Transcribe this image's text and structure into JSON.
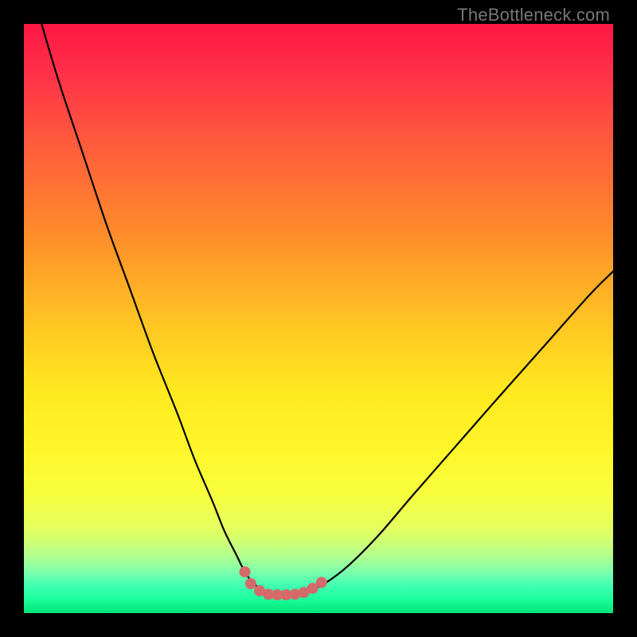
{
  "watermark": "TheBottleneck.com",
  "colors": {
    "black": "#000000",
    "curve": "#000000",
    "marker": "#d46a6a",
    "gradient_stops": [
      {
        "offset": 0.0,
        "color": "#ff1744"
      },
      {
        "offset": 0.08,
        "color": "#ff2f49"
      },
      {
        "offset": 0.2,
        "color": "#ff5a3c"
      },
      {
        "offset": 0.35,
        "color": "#ff8a2b"
      },
      {
        "offset": 0.5,
        "color": "#ffc223"
      },
      {
        "offset": 0.62,
        "color": "#ffe81f"
      },
      {
        "offset": 0.72,
        "color": "#fff629"
      },
      {
        "offset": 0.8,
        "color": "#f7ff3e"
      },
      {
        "offset": 0.86,
        "color": "#e2ff62"
      },
      {
        "offset": 0.9,
        "color": "#b7ff8a"
      },
      {
        "offset": 0.93,
        "color": "#7cffad"
      },
      {
        "offset": 0.955,
        "color": "#3dffb2"
      },
      {
        "offset": 0.975,
        "color": "#1eff9d"
      },
      {
        "offset": 1.0,
        "color": "#00e676"
      }
    ]
  },
  "chart_data": {
    "type": "line",
    "title": "",
    "xlabel": "",
    "ylabel": "",
    "xlim": [
      0,
      100
    ],
    "ylim": [
      0,
      100
    ],
    "grid": false,
    "series": [
      {
        "name": "bottleneck-curve",
        "x": [
          3,
          6,
          10,
          14,
          18,
          22,
          26,
          29,
          32,
          34,
          36,
          37.5,
          39,
          40.5,
          42,
          43.5,
          45,
          48,
          51,
          55,
          60,
          66,
          73,
          80,
          88,
          96,
          100
        ],
        "y": [
          100,
          90,
          78,
          66,
          55,
          44,
          34,
          26,
          19,
          14,
          10,
          7,
          5,
          4,
          3.3,
          3.1,
          3.2,
          3.6,
          5,
          8,
          13,
          20,
          28,
          36,
          45,
          54,
          58
        ]
      }
    ],
    "markers": {
      "name": "minimum-plateau",
      "points": [
        {
          "x": 37.5,
          "y": 7.0
        },
        {
          "x": 38.5,
          "y": 5.0
        },
        {
          "x": 40.0,
          "y": 3.8
        },
        {
          "x": 41.5,
          "y": 3.2
        },
        {
          "x": 43.0,
          "y": 3.1
        },
        {
          "x": 44.5,
          "y": 3.1
        },
        {
          "x": 46.0,
          "y": 3.2
        },
        {
          "x": 47.5,
          "y": 3.5
        },
        {
          "x": 49.0,
          "y": 4.2
        },
        {
          "x": 50.5,
          "y": 5.2
        }
      ],
      "radius": 7
    }
  }
}
